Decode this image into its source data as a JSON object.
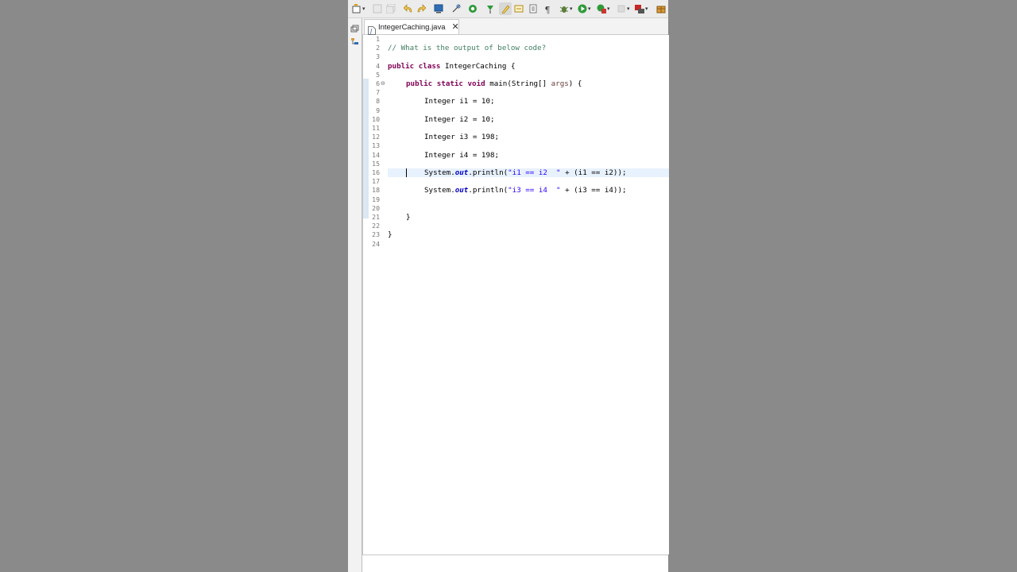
{
  "tab": {
    "filename": "IntegerCaching.java",
    "close_glyph": "✕"
  },
  "icons": {
    "tab": "java-file-icon",
    "toolbar": [
      "new-wizard-icon",
      "save-icon",
      "save-all-icon",
      "undo-icon",
      "redo-icon",
      "terminal-icon",
      "link-icon",
      "target-icon",
      "pin-icon",
      "highlight-icon",
      "toggle-icon",
      "block-select-icon",
      "show-whitespace-icon",
      "debug-icon",
      "run-icon",
      "coverage-icon",
      "stop-icon",
      "external-tools-icon",
      "package-icon"
    ],
    "left_strip": [
      "restore-icon",
      "hierarchy-icon"
    ]
  },
  "colors": {
    "keyword": "#7f0055",
    "comment": "#3f7f5f",
    "string": "#2a00ff",
    "field": "#0000c0",
    "current_line": "#e8f2fe",
    "background": "#8a8a8a"
  },
  "code": {
    "line_numbers": [
      "1",
      "2",
      "3",
      "4",
      "5",
      "6",
      "7",
      "8",
      "9",
      "10",
      "11",
      "12",
      "13",
      "14",
      "15",
      "16",
      "17",
      "18",
      "19",
      "20",
      "21",
      "22",
      "23",
      "24"
    ],
    "comment": "// What is the output of below code?",
    "class_decl": {
      "kw1": "public",
      "kw2": "class",
      "name": "IntegerCaching {"
    },
    "main_decl": {
      "kw1": "public",
      "kw2": "static",
      "kw3": "void",
      "rest": "main(String[] ",
      "param": "args",
      "tail": ") {"
    },
    "decls": [
      "Integer i1 = 10;",
      "Integer i2 = 10;",
      "Integer i3 = 198;",
      "Integer i4 = 198;"
    ],
    "print1": {
      "sys": "System.",
      "out": "out",
      "mid": ".println(",
      "str": "\"i1 == i2  \"",
      "tail": " + (i1 == i2));"
    },
    "print2": {
      "sys": "System.",
      "out": "out",
      "mid": ".println(",
      "str": "\"i3 == i4  \"",
      "tail": " + (i3 == i4));"
    },
    "close_method": "}",
    "close_class": "}"
  }
}
